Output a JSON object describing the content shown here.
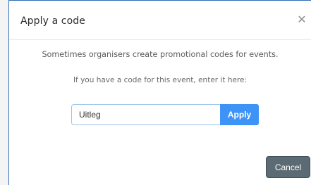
{
  "modal": {
    "title": "Apply a code",
    "close_icon": "close-icon"
  },
  "body": {
    "lead_text": "Sometimes organisers create promotional codes for events.",
    "sub_text": "If you have a code for this event, enter it here:"
  },
  "form": {
    "code_value": "Uitleg",
    "apply_label": "Apply"
  },
  "footer": {
    "cancel_label": "Cancel"
  },
  "colors": {
    "accent": "#3d94f6",
    "cancel": "#5c6b73",
    "border_accent": "#2e6fb5"
  }
}
